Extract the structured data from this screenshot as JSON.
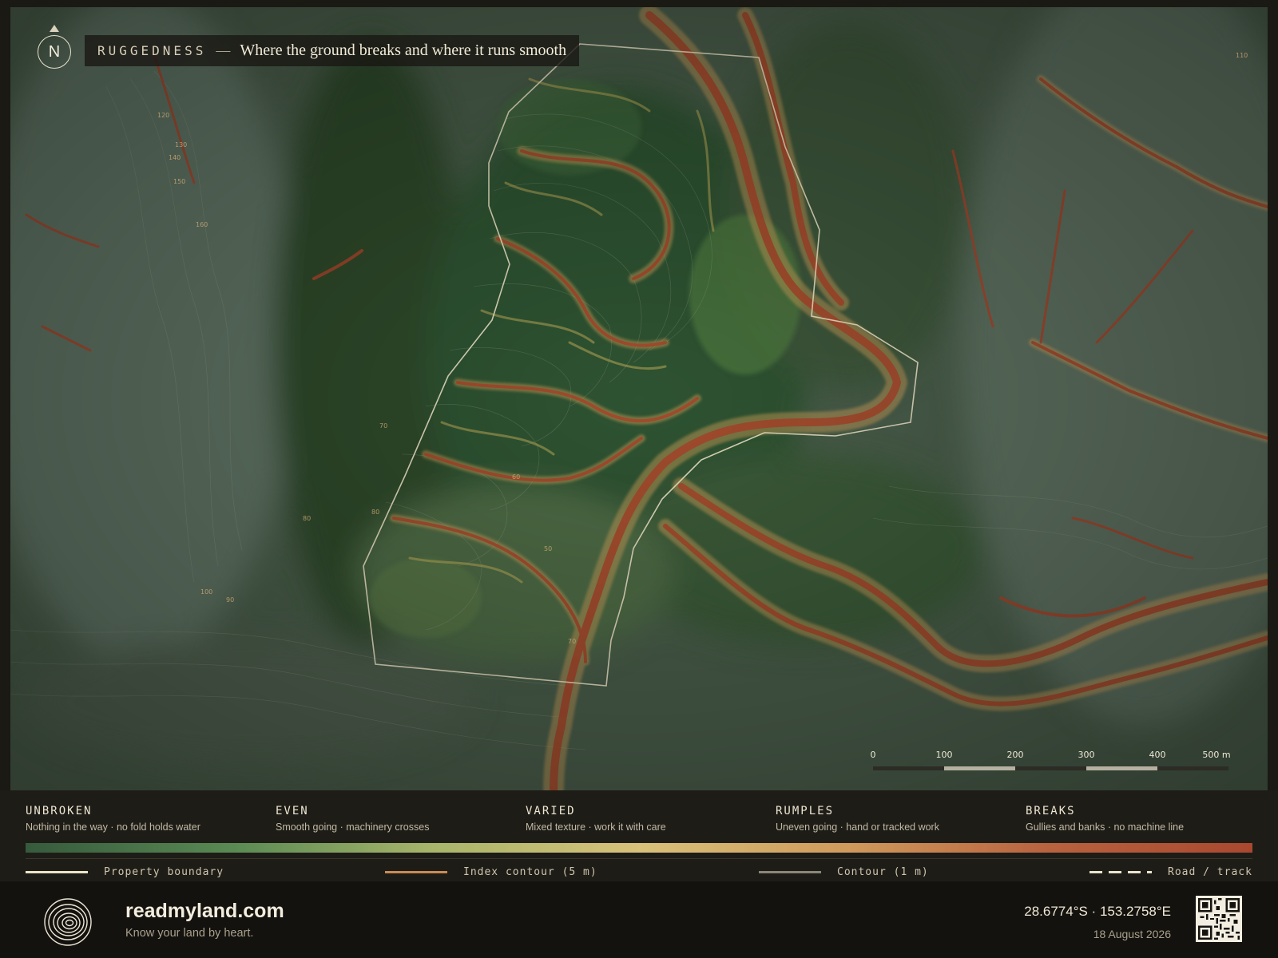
{
  "map": {
    "north_label": "N",
    "title": {
      "label": "RUGGEDNESS",
      "separator": "—",
      "subtitle": "Where the ground breaks and where it runs smooth"
    },
    "contour_labels": [
      "110",
      "120",
      "130",
      "140",
      "150",
      "160",
      "70",
      "80",
      "100",
      "90",
      "80",
      "60",
      "50",
      "70"
    ],
    "scale_bar": {
      "ticks": [
        "0",
        "100",
        "200",
        "300",
        "400",
        "500 m"
      ]
    }
  },
  "legend": {
    "classes": [
      {
        "name": "UNBROKEN",
        "desc": "Nothing in the way · no fold holds water"
      },
      {
        "name": "EVEN",
        "desc": "Smooth going · machinery crosses"
      },
      {
        "name": "VARIED",
        "desc": "Mixed texture · work it with care"
      },
      {
        "name": "RUMPLES",
        "desc": "Uneven going · hand or tracked work"
      },
      {
        "name": "BREAKS",
        "desc": "Gullies and banks · no machine line"
      }
    ],
    "ramp_colors": [
      "#365a3c",
      "#5a8a54",
      "#a7b56a",
      "#d8c17a",
      "#cf9a5c",
      "#b9633f",
      "#a9482f"
    ],
    "lines": {
      "boundary": "Property boundary",
      "index_contour": "Index contour (5 m)",
      "contour": "Contour (1 m)",
      "road": "Road / track"
    },
    "line_colors": {
      "boundary": "#ece3c6",
      "index_contour": "#c98b54",
      "contour": "#8a8778"
    }
  },
  "footer": {
    "brand": "readmyland.com",
    "tagline": "Know your land by heart.",
    "coordinates": "28.6774°S · 153.2758°E",
    "date": "18 August 2026"
  }
}
